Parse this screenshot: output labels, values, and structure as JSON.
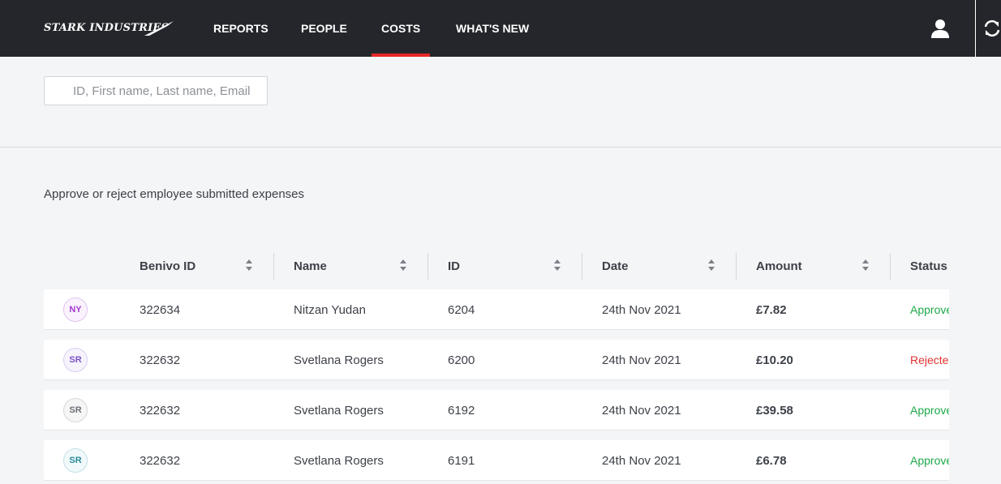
{
  "brand": {
    "name": "STARK INDUSTRIES"
  },
  "nav": [
    {
      "label": "REPORTS"
    },
    {
      "label": "PEOPLE"
    },
    {
      "label": "COSTS",
      "active": true
    },
    {
      "label": "WHAT'S NEW"
    }
  ],
  "header_icons": [
    "user-icon",
    "refresh-icon"
  ],
  "search": {
    "placeholder": "ID, First name, Last name, Email",
    "value": ""
  },
  "subtitle": "Approve or reject employee submitted expenses",
  "table": {
    "columns": [
      "Benivo ID",
      "Name",
      "ID",
      "Date",
      "Amount",
      "Status"
    ],
    "rows": [
      {
        "initials": "NY",
        "benivo_id": "322634",
        "name": "Nitzan Yudan",
        "id": "6204",
        "date": "24th Nov 2021",
        "amount": "£7.82",
        "status": "Approve"
      },
      {
        "initials": "SR",
        "benivo_id": "322632",
        "name": "Svetlana Rogers",
        "id": "6200",
        "date": "24th Nov 2021",
        "amount": "£10.20",
        "status": "Rejecte"
      },
      {
        "initials": "SR",
        "benivo_id": "322632",
        "name": "Svetlana Rogers",
        "id": "6192",
        "date": "24th Nov 2021",
        "amount": "£39.58",
        "status": "Approve"
      },
      {
        "initials": "SR",
        "benivo_id": "322632",
        "name": "Svetlana Rogers",
        "id": "6191",
        "date": "24th Nov 2021",
        "amount": "£6.78",
        "status": "Approve"
      }
    ]
  },
  "colors": {
    "topbar": "#24262b",
    "active_tab": "#e32727",
    "approved": "#1fa84a",
    "rejected": "#e0312f",
    "avatar_ny": "#a43ad0",
    "avatar_sr_1": "#7a52c7",
    "avatar_sr_2": "#6b6f76",
    "avatar_sr_3": "#2b8c9a"
  }
}
